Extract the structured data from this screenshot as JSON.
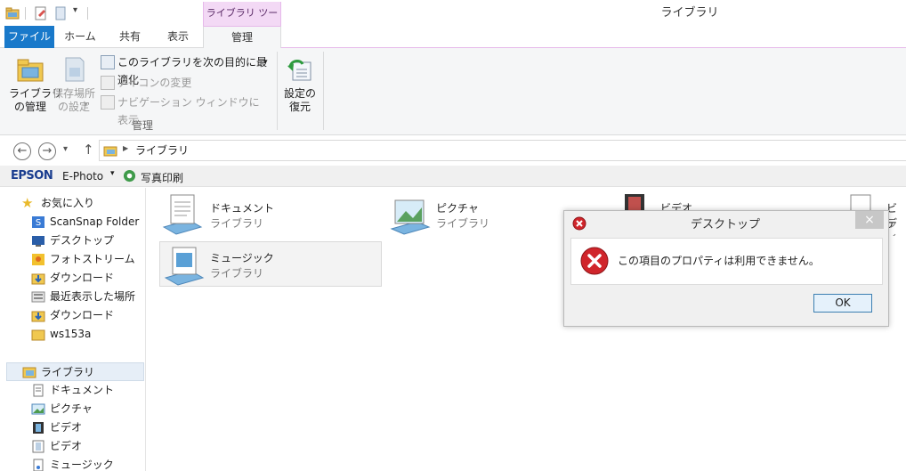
{
  "window": {
    "title": "ライブラリ",
    "context_tab_header": "ライブラリ ツール"
  },
  "tabs": {
    "file": "ファイル",
    "home": "ホーム",
    "share": "共有",
    "view": "表示",
    "manage": "管理"
  },
  "ribbon": {
    "manage_library": "ライブラリ\nの管理",
    "set_save_location": "保存場所\nの設定",
    "optimize_library": "このライブラリを次の目的に最適化",
    "change_icon": "アイコンの変更",
    "show_in_nav": "ナビゲーション ウィンドウに表示",
    "group_label": "管理",
    "restore_settings": "設定の\n復元"
  },
  "address": {
    "path": "ライブラリ"
  },
  "epson": {
    "brand": "EPSON",
    "app": "E-Photo",
    "print": "写真印刷"
  },
  "nav": {
    "favorites": "お気に入り",
    "favorite_items": [
      "ScanSnap Folder",
      "デスクトップ",
      "フォトストリーム",
      "ダウンロード",
      "最近表示した場所",
      "ダウンロード",
      "ws153a"
    ],
    "libraries": "ライブラリ",
    "library_items": [
      "ドキュメント",
      "ピクチャ",
      "ビデオ",
      "ビデオ",
      "ミュージック"
    ]
  },
  "content": {
    "library_word": "ライブラリ",
    "tiles": [
      "ドキュメント",
      "ピクチャ",
      "ビデオ",
      "ビデ",
      "ミュージック"
    ],
    "partial_sub": "ライ"
  },
  "dialog": {
    "title": "デスクトップ",
    "message": "この項目のプロパティは利用できません。",
    "ok": "OK",
    "close": "×"
  },
  "colors": {
    "file_tab": "#1979ca",
    "context_tab": "#f3d9f5",
    "error_red": "#d0252b"
  }
}
